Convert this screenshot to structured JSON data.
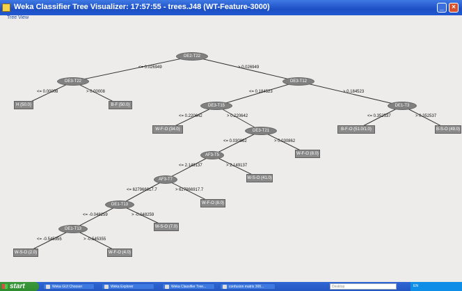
{
  "window": {
    "title": "Weka Classifier Tree Visualizer: 17:57:55 - trees.J48 (WT-Feature-3000)",
    "menu_label": "Tree View"
  },
  "tree": {
    "nodes": {
      "root": "DE2-T22",
      "n_de3_t22": "DE3-T22",
      "n_de3_t12": "DE3-T12",
      "leaf_h": "H (50.0)",
      "leaf_bf_50": "B-F (50.0)",
      "n_de3_t15": "DE3-T15",
      "n_de1_t3": "DE1-T3",
      "leaf_wfo_34": "W-F-O (34.0)",
      "n_de3_t21": "DE3-T21",
      "leaf_bfo_51": "B-F-O (51.0/1.0)",
      "leaf_bso_49": "B-S-O (49.0)",
      "n_af3_t5": "AF3-T5",
      "leaf_wfo_8a": "W-F-O (8.0)",
      "n_af3_t7": "AF3-T7",
      "leaf_wso_41": "W-S-O (41.0)",
      "n_de1_t13a": "DE1-T13",
      "leaf_wfo_8b": "W-F-O (8.0)",
      "n_de1_t13b": "DE1-T13",
      "leaf_wso_7": "W-S-O (7.0)",
      "leaf_wso_2": "W-S-O (2.0)",
      "leaf_wfo_4": "W-F-O (4.0)"
    },
    "edges": {
      "e1": "<= 0.026949",
      "e2": "> 0.026949",
      "e3": "<= 0.00008",
      "e4": "> 0.00008",
      "e5": "<= 0.184523",
      "e6": "> 0.184523",
      "e7": "<= 0.220642",
      "e8": "> 0.220642",
      "e9": "<= 0.352537",
      "e10": "> 0.352537",
      "e11": "<= 0.030862",
      "e12": "> 0.030862",
      "e13": "<= 2.149137",
      "e14": "> 2.149137",
      "e15": "<= 627966917.7",
      "e16": "> 627966917.7",
      "e17": "<= -0.048259",
      "e18": "> -0.048259",
      "e19": "<= -0.545355",
      "e20": "> -0.545355"
    }
  },
  "taskbar": {
    "start": "start",
    "tasks": [
      "Weka GUI Chooser",
      "Weka Explorer",
      "Weka Classifier Tree...",
      "confusion matrix 300..."
    ],
    "search_placeholder": "Desktop",
    "tray": "EN"
  },
  "colors": {
    "titlebar": "#2259d0",
    "node_fill": "#808080",
    "taskbar": "#2456c2",
    "start_button": "#2e8b2e"
  }
}
